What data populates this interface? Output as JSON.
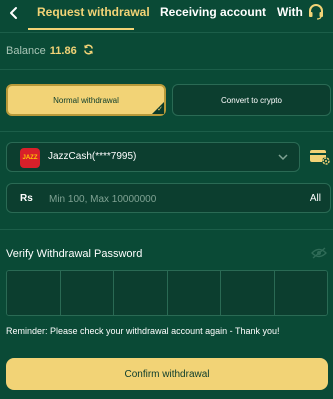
{
  "header": {
    "tabs": [
      {
        "label": "Request withdrawal",
        "active": true
      },
      {
        "label": "Receiving account",
        "active": false
      },
      {
        "label": "With",
        "active": false
      }
    ]
  },
  "balance": {
    "label": "Balance",
    "amount": "11.86"
  },
  "modes": {
    "normal_label": "Normal withdrawal",
    "crypto_label": "Convert to crypto"
  },
  "account": {
    "selected": "JazzCash(****7995)",
    "logo_text": "JAZZ"
  },
  "amount": {
    "currency": "Rs",
    "placeholder": "Min 100, Max 10000000",
    "all_label": "All"
  },
  "verify": {
    "title": "Verify Withdrawal Password",
    "pin_cells": 6
  },
  "reminder": "Reminder:  Please check your withdrawal account again - Thank you!",
  "confirm_label": "Confirm withdrawal",
  "colors": {
    "background": "#0a4a36",
    "accent": "#f2d376",
    "panel": "#0c3e2f"
  }
}
